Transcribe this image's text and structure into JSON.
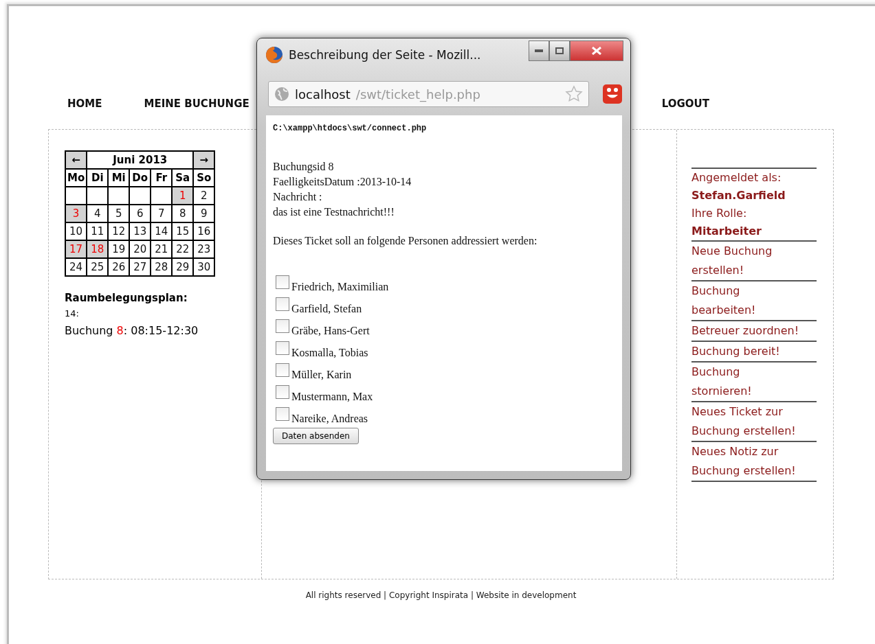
{
  "nav": [
    {
      "label": "HOME"
    },
    {
      "label": "MEINE BUCHUNGE"
    },
    {
      "label": "LOGOUT"
    }
  ],
  "calendar": {
    "prev": "←",
    "month": "Juni 2013",
    "next": "→",
    "weekdays": [
      "Mo",
      "Di",
      "Mi",
      "Do",
      "Fr",
      "Sa",
      "So"
    ],
    "weeks": [
      [
        {
          "day": "1",
          "marked": true
        },
        {
          "day": "2",
          "marked": false
        }
      ],
      [
        {
          "day": "3",
          "marked": true
        },
        {
          "day": "4",
          "marked": false
        },
        {
          "day": "5",
          "marked": false
        },
        {
          "day": "6",
          "marked": false
        },
        {
          "day": "7",
          "marked": false
        },
        {
          "day": "8",
          "marked": false
        },
        {
          "day": "9",
          "marked": false
        }
      ],
      [
        {
          "day": "10",
          "marked": false
        },
        {
          "day": "11",
          "marked": false
        },
        {
          "day": "12",
          "marked": false
        },
        {
          "day": "13",
          "marked": false
        },
        {
          "day": "14",
          "marked": false
        },
        {
          "day": "15",
          "marked": false
        },
        {
          "day": "16",
          "marked": false
        }
      ],
      [
        {
          "day": "17",
          "marked": true
        },
        {
          "day": "18",
          "marked": true
        },
        {
          "day": "19",
          "marked": false
        },
        {
          "day": "20",
          "marked": false
        },
        {
          "day": "21",
          "marked": false
        },
        {
          "day": "22",
          "marked": false
        },
        {
          "day": "23",
          "marked": false
        }
      ],
      [
        {
          "day": "24",
          "marked": false
        },
        {
          "day": "25",
          "marked": false
        },
        {
          "day": "26",
          "marked": false
        },
        {
          "day": "27",
          "marked": false
        },
        {
          "day": "28",
          "marked": false
        },
        {
          "day": "29",
          "marked": false
        },
        {
          "day": "30",
          "marked": false
        }
      ]
    ]
  },
  "schedule": {
    "title": "Raumbelegungsplan:",
    "day": "14:",
    "entries": [
      {
        "label": "Buchung",
        "number": "8",
        "time": ": 08:15-12:30"
      }
    ]
  },
  "user": {
    "logged_in_label": "Angemeldet als:",
    "username": "Stefan.Garfield",
    "role_label": "Ihre Rolle:",
    "role": "Mitarbeiter"
  },
  "actions": [
    "Neue Buchung erstellen!",
    "Buchung bearbeiten!",
    "Betreuer zuordnen!",
    "Buchung bereit!",
    "Buchung stornieren!",
    "Neues Ticket zur Buchung erstellen!",
    "Neues Notiz zur Buchung erstellen!"
  ],
  "footer": "All rights reserved | Copyright Inspirata | Website in development",
  "popup": {
    "title": "Beschreibung der Seite - Mozill...",
    "url_host": "localhost",
    "url_path": "/swt/ticket_help.php",
    "path_line": "C:\\xampp\\htdocs\\swt/connect.php",
    "lines": [
      "Buchungsid 8",
      "FaelligkeitsDatum :2013-10-14",
      "Nachricht :",
      "das ist eine Testnachricht!!!"
    ],
    "prompt": "Dieses Ticket soll an folgende Personen addressiert werden:",
    "recipients": [
      {
        "name": "Friedrich, Maximilian",
        "checked": false
      },
      {
        "name": "Garfield, Stefan",
        "checked": false
      },
      {
        "name": "Gräbe, Hans-Gert",
        "checked": false
      },
      {
        "name": "Kosmalla, Tobias",
        "checked": false
      },
      {
        "name": "Müller, Karin",
        "checked": false
      },
      {
        "name": "Mustermann, Max",
        "checked": false
      },
      {
        "name": "Nareike, Andreas",
        "checked": false
      }
    ],
    "submit": "Daten absenden"
  }
}
